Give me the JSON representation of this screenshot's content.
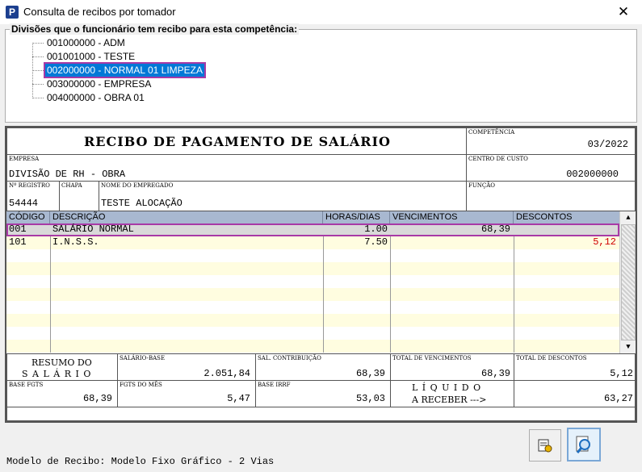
{
  "window": {
    "title": "Consulta de recibos por tomador",
    "close_label": "✕"
  },
  "divisions": {
    "legend": "Divisões que o funcionário tem recibo para esta competência:",
    "items": [
      {
        "label": "001000000 - ADM",
        "selected": false
      },
      {
        "label": "001001000 - TESTE",
        "selected": false
      },
      {
        "label": "002000000 - NORMAL 01 LIMPEZA",
        "selected": true
      },
      {
        "label": "003000000 - EMPRESA",
        "selected": false
      },
      {
        "label": "004000000 - OBRA 01",
        "selected": false
      }
    ]
  },
  "receipt": {
    "title": "RECIBO DE PAGAMENTO DE SALÁRIO",
    "competencia_label": "COMPETÊNCIA",
    "competencia": "03/2022",
    "empresa_label": "EMPRESA",
    "empresa": "DIVISÃO DE RH - OBRA",
    "centro_custo_label": "CENTRO DE CUSTO",
    "centro_custo": "002000000",
    "registro_label": "Nº REGISTRO",
    "registro": "54444",
    "chapa_label": "CHAPA",
    "chapa": "",
    "nome_label": "NOME DO EMPREGADO",
    "nome": "TESTE ALOCAÇÃO",
    "funcao_label": "FUNÇÃO",
    "funcao": "",
    "columns": [
      "CÓDIGO",
      "DESCRIÇÃO",
      "HORAS/DIAS",
      "VENCIMENTOS",
      "DESCONTOS"
    ],
    "rows": [
      {
        "codigo": "001",
        "descricao": "SALÁRIO NORMAL",
        "horas": "1.00",
        "vencimentos": "68,39",
        "descontos": "",
        "selected": true
      },
      {
        "codigo": "101",
        "descricao": "I.N.S.S.",
        "horas": "7.50",
        "vencimentos": "",
        "descontos": "5,12",
        "selected": false
      }
    ],
    "resumo_line1": "RESUMO DO",
    "resumo_line2": "S A L Á R I O",
    "salario_base_label": "SALÁRIO-BASE",
    "salario_base": "2.051,84",
    "sal_contrib_label": "SAL. CONTRIBUIÇÃO",
    "sal_contrib": "68,39",
    "total_venc_label": "TOTAL DE VENCIMENTOS",
    "total_venc": "68,39",
    "total_desc_label": "TOTAL DE DESCONTOS",
    "total_desc": "5,12",
    "base_fgts_label": "BASE FGTS",
    "base_fgts": "68,39",
    "fgts_mes_label": "FGTS DO MÊS",
    "fgts_mes": "5,47",
    "base_irrf_label": "BASE IRRF",
    "base_irrf": "53,03",
    "liquido_line1": "L Í Q U I D O",
    "liquido_line2": "A RECEBER --->",
    "liquido": "63,27"
  },
  "footer": {
    "modelo": "Modelo de Recibo: Modelo Fixo Gráfico - 2 Vias"
  },
  "colors": {
    "selection": "#0078d7",
    "highlight_outline": "#a83aa6",
    "grid_header": "#a8b8d0",
    "stripe": "#fffde0",
    "discount_red": "#d00000"
  }
}
